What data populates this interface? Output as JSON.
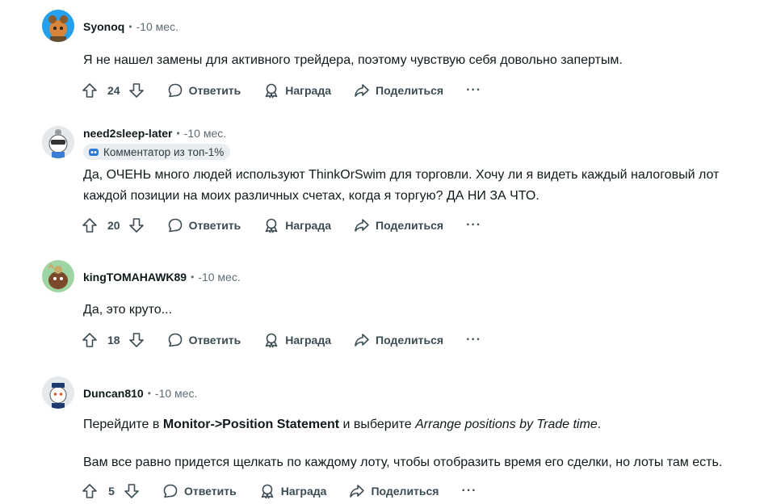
{
  "comments": [
    {
      "author": "Syonoq",
      "time": "-10 мес.",
      "paragraphs": [
        {
          "plain": "Я не нашел замены для активного трейдера, поэтому чувствую себя довольно запертым."
        }
      ],
      "votes": "24"
    },
    {
      "author": "need2sleep-later",
      "time": "-10 мес.",
      "flair": "Комментатор из топ-1%",
      "paragraphs": [
        {
          "plain": "Да, ОЧЕНЬ много людей используют ThinkOrSwim для торговли. Хочу ли я видеть каждый налоговый лот"
        },
        {
          "plain": "каждой позиции на моих различных счетах, когда я торгую? ДА НИ ЗА ЧТО."
        }
      ],
      "votes": "20"
    },
    {
      "author": "kingTOMAHAWK89",
      "time": "-10 мес.",
      "paragraphs": [
        {
          "plain": "Да, это круто..."
        }
      ],
      "votes": "18"
    },
    {
      "author": "Duncan810",
      "time": "-10 мес.",
      "paragraph1": {
        "part1": "Перейдите в ",
        "bold": "Monitor->Position Statement",
        "part2": " и выберите ",
        "italic": "Arrange positions by Trade time",
        "part3": "."
      },
      "paragraph2": "Вам все равно придется щелкать по каждому лоту, чтобы отобразить время его сделки, но лоты там есть.",
      "votes": "5"
    }
  ],
  "actions": {
    "reply": "Ответить",
    "award": "Награда",
    "share": "Поделиться",
    "more": "···"
  },
  "separator": "•",
  "icons": {
    "upvote": "upvote-arrow-icon",
    "downvote": "downvote-arrow-icon",
    "reply": "speech-bubble-icon",
    "award": "award-ribbon-icon",
    "share": "share-arrow-icon",
    "more": "ellipsis-icon"
  },
  "colors": {
    "text": "#0f1a1c",
    "muted": "#5c6c74",
    "action": "#3b4c54",
    "flair_bg": "#eaedef"
  }
}
